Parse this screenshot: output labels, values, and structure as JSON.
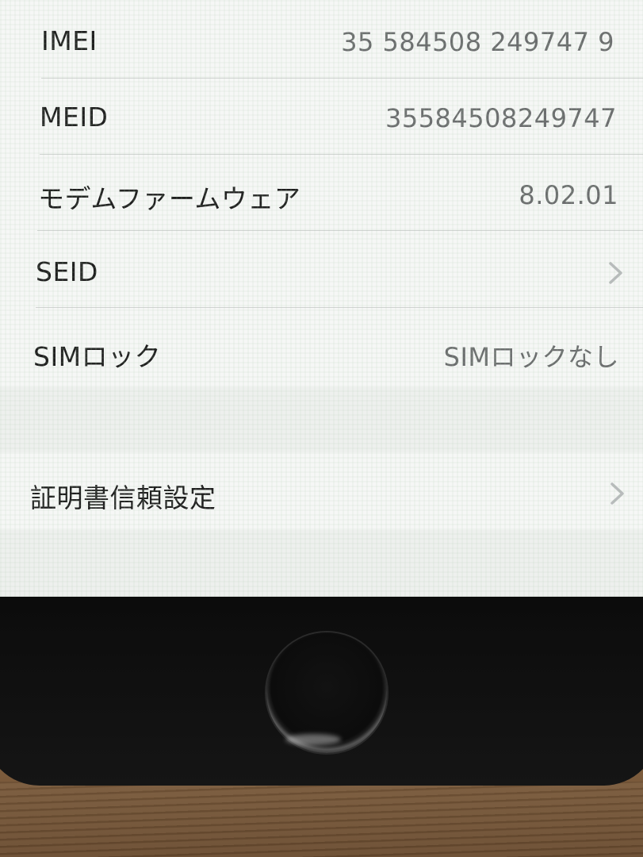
{
  "settings": {
    "rows": [
      {
        "label": "IMEI",
        "value": "35 584508 249747 9"
      },
      {
        "label": "MEID",
        "value": "35584508249747"
      },
      {
        "label": "モデムファームウェア",
        "value": "8.02.01"
      },
      {
        "label": "SEID",
        "value": ""
      },
      {
        "label": "SIMロック",
        "value": "SIMロックなし"
      }
    ],
    "certificate_trust": {
      "label": "証明書信頼設定"
    }
  },
  "icons": {
    "disclosure": "chevron-right-icon"
  },
  "colors": {
    "label_text": "#1f1f1f",
    "value_text": "#6b6d6e",
    "cell_background": "#f6f7f6",
    "grouped_background": "#eef0ee",
    "chevron": "#b8bbbc",
    "separator": "#d0d3d1"
  }
}
